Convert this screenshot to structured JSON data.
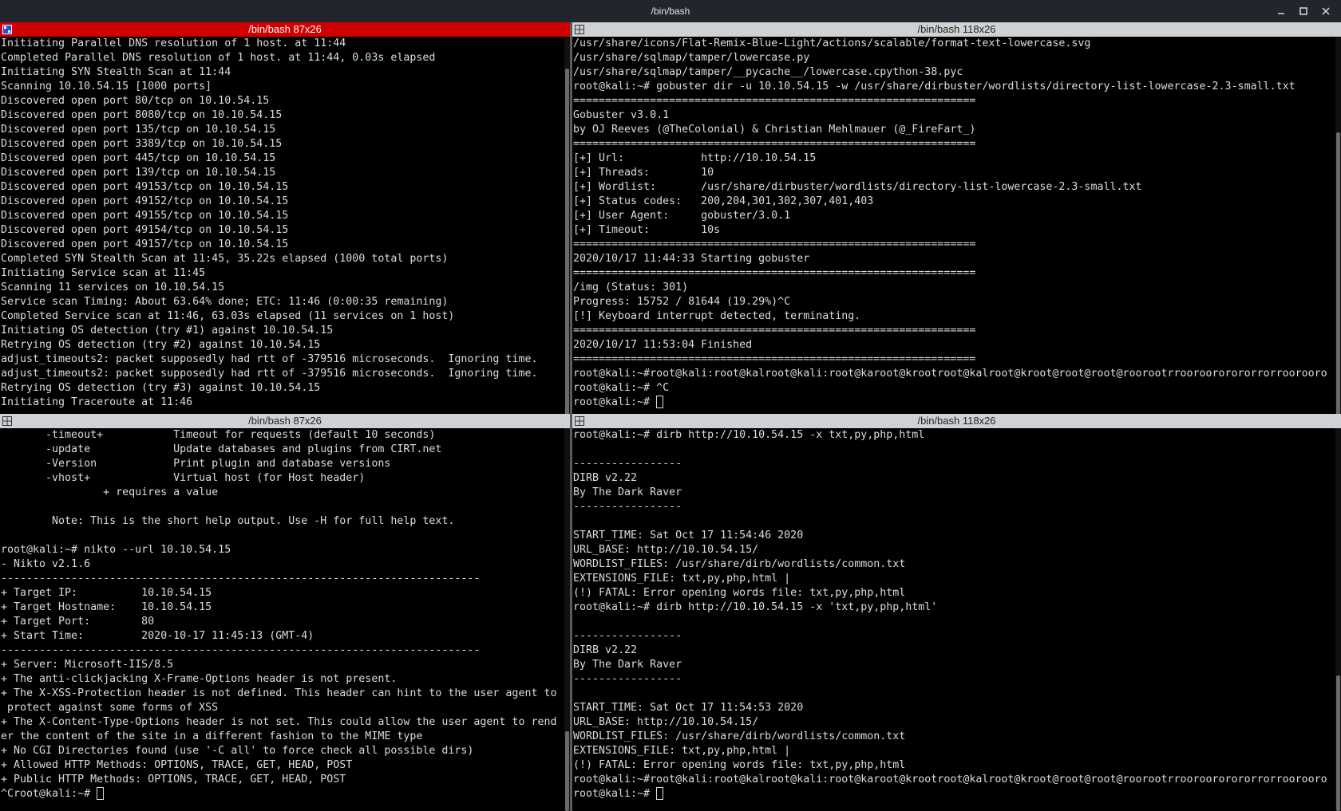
{
  "window": {
    "title": "/bin/bash"
  },
  "panes": {
    "top_left": {
      "title": "/bin/bash 87x26",
      "lines": [
        "Initiating Parallel DNS resolution of 1 host. at 11:44",
        "Completed Parallel DNS resolution of 1 host. at 11:44, 0.03s elapsed",
        "Initiating SYN Stealth Scan at 11:44",
        "Scanning 10.10.54.15 [1000 ports]",
        "Discovered open port 80/tcp on 10.10.54.15",
        "Discovered open port 8080/tcp on 10.10.54.15",
        "Discovered open port 135/tcp on 10.10.54.15",
        "Discovered open port 3389/tcp on 10.10.54.15",
        "Discovered open port 445/tcp on 10.10.54.15",
        "Discovered open port 139/tcp on 10.10.54.15",
        "Discovered open port 49153/tcp on 10.10.54.15",
        "Discovered open port 49152/tcp on 10.10.54.15",
        "Discovered open port 49155/tcp on 10.10.54.15",
        "Discovered open port 49154/tcp on 10.10.54.15",
        "Discovered open port 49157/tcp on 10.10.54.15",
        "Completed SYN Stealth Scan at 11:45, 35.22s elapsed (1000 total ports)",
        "Initiating Service scan at 11:45",
        "Scanning 11 services on 10.10.54.15",
        "Service scan Timing: About 63.64% done; ETC: 11:46 (0:00:35 remaining)",
        "Completed Service scan at 11:46, 63.03s elapsed (11 services on 1 host)",
        "Initiating OS detection (try #1) against 10.10.54.15",
        "Retrying OS detection (try #2) against 10.10.54.15",
        "adjust_timeouts2: packet supposedly had rtt of -379516 microseconds.  Ignoring time.",
        "adjust_timeouts2: packet supposedly had rtt of -379516 microseconds.  Ignoring time.",
        "Retrying OS detection (try #3) against 10.10.54.15",
        "Initiating Traceroute at 11:46"
      ],
      "cursor_line": null
    },
    "top_right": {
      "title": "/bin/bash 118x26",
      "lines": [
        "/usr/share/icons/Flat-Remix-Blue-Light/actions/scalable/format-text-lowercase.svg",
        "/usr/share/sqlmap/tamper/lowercase.py",
        "/usr/share/sqlmap/tamper/__pycache__/lowercase.cpython-38.pyc",
        "root@kali:~# gobuster dir -u 10.10.54.15 -w /usr/share/dirbuster/wordlists/directory-list-lowercase-2.3-small.txt",
        "===============================================================",
        "Gobuster v3.0.1",
        "by OJ Reeves (@TheColonial) & Christian Mehlmauer (@_FireFart_)",
        "===============================================================",
        "[+] Url:            http://10.10.54.15",
        "[+] Threads:        10",
        "[+] Wordlist:       /usr/share/dirbuster/wordlists/directory-list-lowercase-2.3-small.txt",
        "[+] Status codes:   200,204,301,302,307,401,403",
        "[+] User Agent:     gobuster/3.0.1",
        "[+] Timeout:        10s",
        "===============================================================",
        "2020/10/17 11:44:33 Starting gobuster",
        "===============================================================",
        "/img (Status: 301)",
        "Progress: 15752 / 81644 (19.29%)^C",
        "[!] Keyboard interrupt detected, terminating.",
        "===============================================================",
        "2020/10/17 11:53:04 Finished",
        "===============================================================",
        "root@kali:~#root@kali:root@kalroot@kali:root@karoot@krootroot@kalroot@kroot@root@root@roorootrrooroororororrorroorooro",
        "root@kali:~# ^C",
        "root@kali:~# "
      ],
      "cursor_line": 25
    },
    "bottom_left": {
      "title": "/bin/bash 87x26",
      "lines": [
        "       -timeout+           Timeout for requests (default 10 seconds)",
        "       -update             Update databases and plugins from CIRT.net",
        "       -Version            Print plugin and database versions",
        "       -vhost+             Virtual host (for Host header)",
        "                + requires a value",
        "",
        "        Note: This is the short help output. Use -H for full help text.",
        "",
        "root@kali:~# nikto --url 10.10.54.15",
        "- Nikto v2.1.6",
        "---------------------------------------------------------------------------",
        "+ Target IP:          10.10.54.15",
        "+ Target Hostname:    10.10.54.15",
        "+ Target Port:        80",
        "+ Start Time:         2020-10-17 11:45:13 (GMT-4)",
        "---------------------------------------------------------------------------",
        "+ Server: Microsoft-IIS/8.5",
        "+ The anti-clickjacking X-Frame-Options header is not present.",
        "+ The X-XSS-Protection header is not defined. This header can hint to the user agent to",
        " protect against some forms of XSS",
        "+ The X-Content-Type-Options header is not set. This could allow the user agent to rend",
        "er the content of the site in a different fashion to the MIME type",
        "+ No CGI Directories found (use '-C all' to force check all possible dirs)",
        "+ Allowed HTTP Methods: OPTIONS, TRACE, GET, HEAD, POST",
        "+ Public HTTP Methods: OPTIONS, TRACE, GET, HEAD, POST",
        "^Croot@kali:~# "
      ],
      "cursor_line": 25
    },
    "bottom_right": {
      "title": "/bin/bash 118x26",
      "lines": [
        "root@kali:~# dirb http://10.10.54.15 -x txt,py,php,html",
        "",
        "-----------------",
        "DIRB v2.22",
        "By The Dark Raver",
        "-----------------",
        "",
        "START_TIME: Sat Oct 17 11:54:46 2020",
        "URL_BASE: http://10.10.54.15/",
        "WORDLIST_FILES: /usr/share/dirb/wordlists/common.txt",
        "EXTENSIONS_FILE: txt,py,php,html |",
        "(!) FATAL: Error opening words file: txt,py,php,html",
        "root@kali:~# dirb http://10.10.54.15 -x 'txt,py,php,html'",
        "",
        "-----------------",
        "DIRB v2.22",
        "By The Dark Raver",
        "-----------------",
        "",
        "START_TIME: Sat Oct 17 11:54:53 2020",
        "URL_BASE: http://10.10.54.15/",
        "WORDLIST_FILES: /usr/share/dirb/wordlists/common.txt",
        "EXTENSIONS_FILE: txt,py,php,html |",
        "(!) FATAL: Error opening words file: txt,py,php,html",
        "root@kali:~#root@kali:root@kalroot@kali:root@karoot@krootroot@kalroot@kroot@root@root@roorootrrooroororororrorroorooro",
        "root@kali:~# "
      ],
      "cursor_line": 25
    }
  },
  "colors": {
    "active_header": "#d10000",
    "inactive_header": "#cfd2d5",
    "terminal_bg": "#000000",
    "terminal_fg": "#dcdcdc"
  }
}
